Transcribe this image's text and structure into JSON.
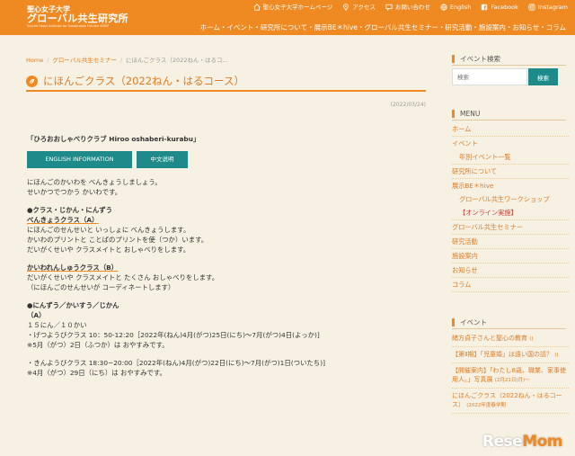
{
  "header": {
    "logo_line1": "聖心女子大学",
    "logo_line2": "グローバル共生研究所",
    "logo_line3": "Sacred Heart Institute for Sustainable Futures SHISF",
    "util_links": [
      {
        "label": "聖心女子大学ホームページ",
        "icon": "home-icon"
      },
      {
        "label": "アクセス",
        "icon": "map-pin-icon"
      },
      {
        "label": "お問い合わせ",
        "icon": "chat-icon"
      },
      {
        "label": "English",
        "icon": "globe-icon"
      },
      {
        "label": "Facebook",
        "icon": "facebook-icon"
      },
      {
        "label": "Instagram",
        "icon": "instagram-icon"
      }
    ],
    "global_nav": "ホーム・イベント・研究所について・展示BE＊hive・グローバル共生セミナー・研究活動・施設案内・お知らせ・コラム"
  },
  "breadcrumb": {
    "home": "Home",
    "parent": "グローバル共生セミナー",
    "current": "にほんごクラス（2022ねん・はるコ..."
  },
  "page": {
    "title": "にほんごクラス（2022ねん・はるコース）",
    "date": "(2022/03/24)"
  },
  "content": {
    "club": "「ひろおおしゃべりクラブ Hiroo oshaberi-kurabu」",
    "btn_en": "ENGLISH INFORMATION",
    "btn_zh": "中文说明",
    "intro1": "にほんごのかいわを べんきょうしましょう。",
    "intro2": "せいかつでつかう かいわです。",
    "sec1": "●クラス・じかん・にんずう",
    "classA_title": "べんきょうクラス（A）",
    "classA_1": "にほんごのせんせいと いっしょに べんきょうします。",
    "classA_2": "かいわのプリントと ことばのプリントを使（つか）います。",
    "classA_3": "だいがくせいや クラスメイトと おしゃべりをします。",
    "classB_title": "かいわれんしゅうクラス（B）",
    "classB_1": "だいがくせいや クラスメイトと たくさん おしゃべりをします。",
    "classB_2": "（にほんごのせんせいが コーディネートします）",
    "sec2": "●にんずう／かいすう／じかん",
    "a_label": "（A）",
    "a_freq": "１５にん／１０かい",
    "a_mon": "・げつようびクラス 10：50-12:20［2022年(ねん)4月(がつ)25日(にち)〜7月(がつ)4日(よっか)]",
    "a_mon_note": "※5月（がつ）2日（ふつか）は おやすみです。",
    "a_fri": "・きんようびクラス 18:30−20:00［2022年(ねん)4月(がつ)22日(にち)〜7月(がつ)1日(ついたち)]",
    "a_fri_note": "※4月（がつ）29日（にち）は おやすみです。"
  },
  "sidebar": {
    "search_title": "イベント検索",
    "search_placeholder": "検索",
    "search_button": "検索",
    "menu_title": "MENU",
    "menu": [
      {
        "label": "ホーム"
      },
      {
        "label": "イベント"
      },
      {
        "label": "年別イベント一覧"
      },
      {
        "label": "研究所について"
      },
      {
        "label": "展示BE＊hive"
      },
      {
        "label": "グローバル共生ワークショップ"
      },
      {
        "label": "【オンライン実施】"
      },
      {
        "label": "グローバル共生セミナー"
      },
      {
        "label": "研究活動"
      },
      {
        "label": "施設案内"
      },
      {
        "label": "お知らせ"
      },
      {
        "label": "コラム"
      }
    ],
    "event_title": "イベント",
    "events": [
      {
        "label": "緒方貞子さんと聖心の教育",
        "count": "()"
      },
      {
        "label": "【第Ⅱ期】「児童婚」は遠い国の話？",
        "count": "()"
      },
      {
        "label": "【開催案内】「わたし8歳、職業、家事使用人。」写真展",
        "date": "(2月21日(月)〜"
      },
      {
        "label": "にほんごクラス（2022ねん・はるコース）",
        "date": "(2022年度春学期"
      }
    ]
  },
  "watermark": {
    "part1": "Rese",
    "part2": "Mom"
  },
  "colors": {
    "accent": "#ef8a22",
    "teal": "#1f8a8a",
    "background": "#f7f1e4"
  }
}
